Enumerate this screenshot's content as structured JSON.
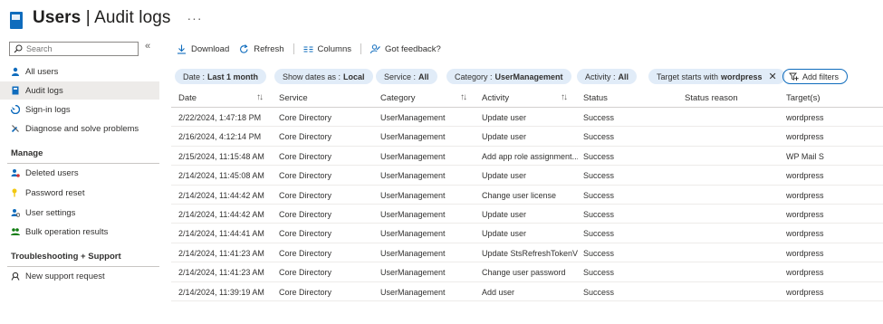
{
  "header": {
    "title_bold": "Users",
    "title_rest": " | Audit logs",
    "more": "···"
  },
  "sidebar": {
    "search_placeholder": "Search",
    "collapse": "«",
    "items": [
      {
        "label": "All users",
        "icon": "user-icon"
      },
      {
        "label": "Audit logs",
        "icon": "book-icon"
      },
      {
        "label": "Sign-in logs",
        "icon": "sign-in-icon"
      },
      {
        "label": "Diagnose and solve problems",
        "icon": "wrench-icon"
      }
    ],
    "manage_title": "Manage",
    "manage_items": [
      {
        "label": "Deleted users",
        "icon": "deleted-users-icon"
      },
      {
        "label": "Password reset",
        "icon": "key-icon"
      },
      {
        "label": "User settings",
        "icon": "settings-icon"
      },
      {
        "label": "Bulk operation results",
        "icon": "bulk-icon"
      }
    ],
    "support_title": "Troubleshooting + Support",
    "support_items": [
      {
        "label": "New support request",
        "icon": "support-icon"
      }
    ]
  },
  "toolbar": {
    "download": "Download",
    "refresh": "Refresh",
    "columns": "Columns",
    "feedback": "Got feedback?"
  },
  "filters": {
    "date_key": "Date :",
    "date_val": "Last 1 month",
    "dates_key": "Show dates as :",
    "dates_val": "Local",
    "service_key": "Service :",
    "service_val": "All",
    "category_key": "Category :",
    "category_val": "UserManagement",
    "activity_key": "Activity :",
    "activity_val": "All",
    "target_key": "Target starts with",
    "target_val": "wordpress",
    "remove": "✕",
    "add": "Add filters"
  },
  "table": {
    "columns": [
      "Date",
      "Service",
      "Category",
      "Activity",
      "Status",
      "Status reason",
      "Target(s)"
    ],
    "sort_glyph": "↑↓",
    "rows": [
      [
        "2/22/2024, 1:47:18 PM",
        "Core Directory",
        "UserManagement",
        "Update user",
        "Success",
        "",
        "wordpress"
      ],
      [
        "2/16/2024, 4:12:14 PM",
        "Core Directory",
        "UserManagement",
        "Update user",
        "Success",
        "",
        "wordpress"
      ],
      [
        "2/15/2024, 11:15:48 AM",
        "Core Directory",
        "UserManagement",
        "Add app role assignment...",
        "Success",
        "",
        "WP Mail S"
      ],
      [
        "2/14/2024, 11:45:08 AM",
        "Core Directory",
        "UserManagement",
        "Update user",
        "Success",
        "",
        "wordpress"
      ],
      [
        "2/14/2024, 11:44:42 AM",
        "Core Directory",
        "UserManagement",
        "Change user license",
        "Success",
        "",
        "wordpress"
      ],
      [
        "2/14/2024, 11:44:42 AM",
        "Core Directory",
        "UserManagement",
        "Update user",
        "Success",
        "",
        "wordpress"
      ],
      [
        "2/14/2024, 11:44:41 AM",
        "Core Directory",
        "UserManagement",
        "Update user",
        "Success",
        "",
        "wordpress"
      ],
      [
        "2/14/2024, 11:41:23 AM",
        "Core Directory",
        "UserManagement",
        "Update StsRefreshTokenV...",
        "Success",
        "",
        "wordpress"
      ],
      [
        "2/14/2024, 11:41:23 AM",
        "Core Directory",
        "UserManagement",
        "Change user password",
        "Success",
        "",
        "wordpress"
      ],
      [
        "2/14/2024, 11:39:19 AM",
        "Core Directory",
        "UserManagement",
        "Add user",
        "Success",
        "",
        "wordpress"
      ]
    ]
  },
  "colors": {
    "accent": "#0f6cbd",
    "pill_bg": "#e1ecf8",
    "active_nav": "#edebe9"
  }
}
